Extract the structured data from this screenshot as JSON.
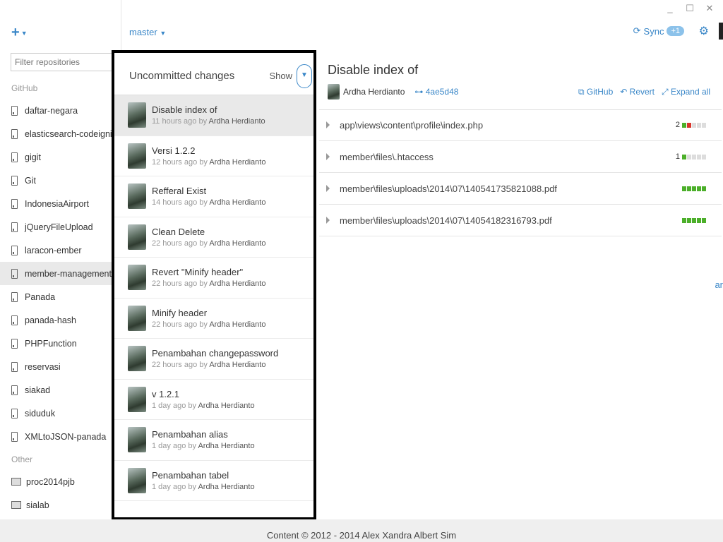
{
  "window": {
    "minimize": "_",
    "maximize": "☐",
    "close": "✕"
  },
  "sidebar": {
    "add_label": "+",
    "filter_placeholder": "Filter repositories",
    "github_section": "GitHub",
    "repos": [
      "daftar-negara",
      "elasticsearch-codeigniter-lib",
      "gigit",
      "Git",
      "IndonesiaAirport",
      "jQueryFileUpload",
      "laracon-ember",
      "member-management",
      "Panada",
      "panada-hash",
      "PHPFunction",
      "reservasi",
      "siakad",
      "siduduk",
      "XMLtoJSON-panada"
    ],
    "active_repo": "member-management",
    "other_section": "Other",
    "other_repos": [
      "proc2014pjb",
      "sialab"
    ]
  },
  "topbar": {
    "branch": "master",
    "sync_label": "Sync",
    "sync_badge": "+1"
  },
  "history": {
    "title": "Uncommitted changes",
    "show_label": "Show",
    "commits": [
      {
        "title": "Disable index of",
        "time": "11 hours ago by",
        "author": "Ardha Herdianto"
      },
      {
        "title": "Versi 1.2.2",
        "time": "12 hours ago by",
        "author": "Ardha Herdianto"
      },
      {
        "title": "Refferal Exist",
        "time": "14 hours ago by",
        "author": "Ardha Herdianto"
      },
      {
        "title": "Clean Delete",
        "time": "22 hours ago by",
        "author": "Ardha Herdianto"
      },
      {
        "title": "Revert \"Minify header\"",
        "time": "22 hours ago by",
        "author": "Ardha Herdianto"
      },
      {
        "title": "Minify header",
        "time": "22 hours ago by",
        "author": "Ardha Herdianto"
      },
      {
        "title": "Penambahan changepassword",
        "time": "22 hours ago by",
        "author": "Ardha Herdianto"
      },
      {
        "title": "v 1.2.1",
        "time": "1 day ago by",
        "author": "Ardha Herdianto"
      },
      {
        "title": "Penambahan alias",
        "time": "1 day ago by",
        "author": "Ardha Herdianto"
      },
      {
        "title": "Penambahan tabel",
        "time": "1 day ago by",
        "author": "Ardha Herdianto"
      }
    ]
  },
  "detail": {
    "title": "Disable index of",
    "author": "Ardha Herdianto",
    "sha": "4ae5d48",
    "actions": {
      "github": "GitHub",
      "revert": "Revert",
      "expand": "Expand all"
    },
    "files": [
      {
        "path": "app\\views\\content\\profile\\index.php",
        "count": "2",
        "bar": "gr"
      },
      {
        "path": "member\\files\\.htaccess",
        "count": "1",
        "bar": "g"
      },
      {
        "path": "member\\files\\uploads\\2014\\07\\140541735821088.pdf",
        "count": "",
        "bar": "ggggg"
      },
      {
        "path": "member\\files\\uploads\\2014\\07\\14054182316793.pdf",
        "count": "",
        "bar": "ggggg"
      }
    ]
  },
  "edge_fragment": "ar",
  "footer": "Content © 2012 - 2014 Alex Xandra Albert Sim"
}
